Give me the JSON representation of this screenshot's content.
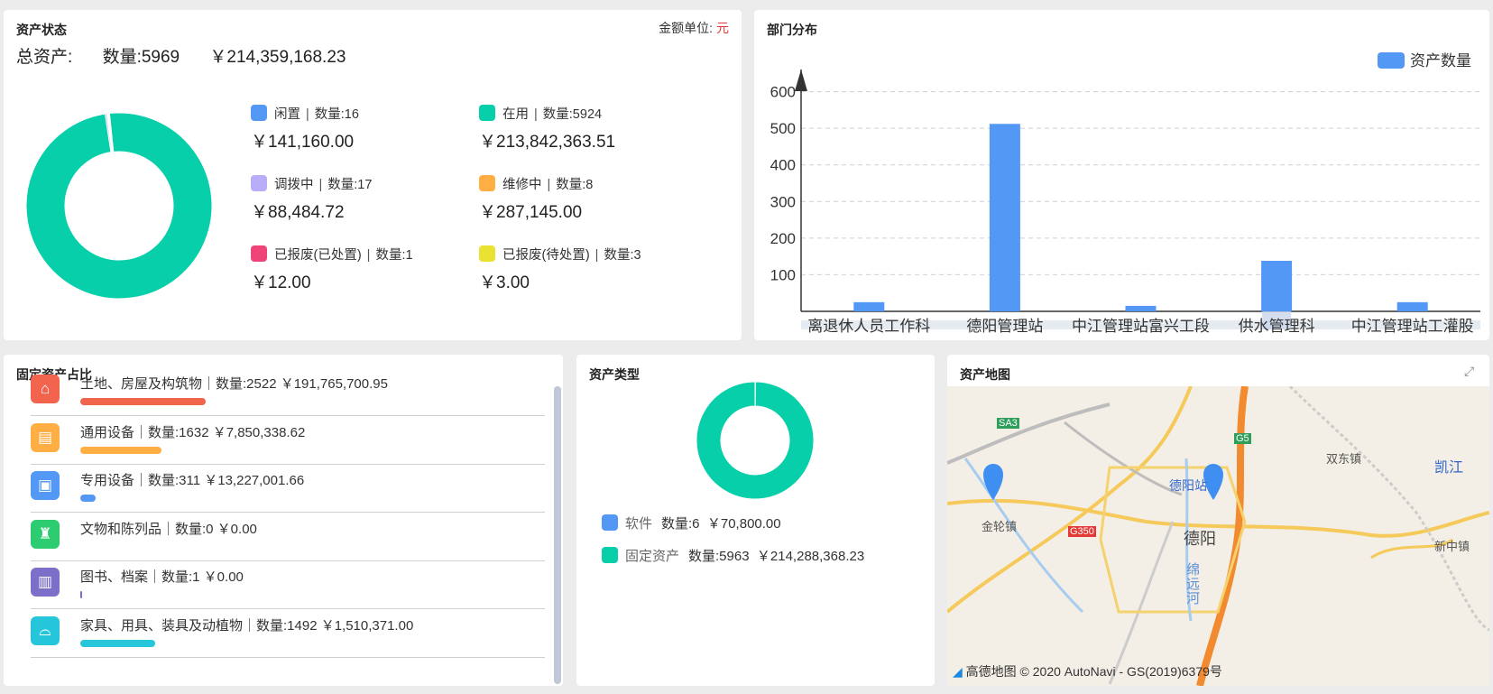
{
  "status_panel": {
    "title": "资产状态",
    "unit_label": "金额单位:",
    "unit_value": "元",
    "total_label": "总资产:",
    "total_count": "数量:5969",
    "total_amount": "￥214,359,168.23",
    "legend": [
      {
        "name": "闲置",
        "count": "数量:16",
        "amount": "￥141,160.00",
        "color": "#5398f5"
      },
      {
        "name": "在用",
        "count": "数量:5924",
        "amount": "￥213,842,363.51",
        "color": "#06cfaa"
      },
      {
        "name": "调拨中",
        "count": "数量:17",
        "amount": "￥88,484.72",
        "color": "#b8aef7"
      },
      {
        "name": "维修中",
        "count": "数量:8",
        "amount": "￥287,145.00",
        "color": "#ffae44"
      },
      {
        "name": "已报废(已处置)",
        "count": "数量:1",
        "amount": "￥12.00",
        "color": "#ef4477"
      },
      {
        "name": "已报废(待处置)",
        "count": "数量:3",
        "amount": "￥3.00",
        "color": "#e9e233"
      }
    ]
  },
  "dept_panel": {
    "title": "部门分布",
    "legend_label": "资产数量",
    "bar_color": "#5398f5"
  },
  "chart_data": [
    {
      "type": "pie",
      "categories": [
        "闲置",
        "在用",
        "调拨中",
        "维修中",
        "已报废(已处置)",
        "已报废(待处置)"
      ],
      "values": [
        16,
        5924,
        17,
        8,
        1,
        3
      ]
    },
    {
      "type": "bar",
      "categories": [
        "离退休人员工作科",
        "德阳管理站",
        "中江管理站富兴工段",
        "供水管理科",
        "中江管理站工灌股"
      ],
      "series": [
        {
          "name": "资产数量",
          "values": [
            25,
            512,
            15,
            138,
            25
          ]
        }
      ],
      "yticks": [
        100,
        200,
        300,
        400,
        500,
        600
      ],
      "ylim": [
        0,
        700
      ],
      "grid": true,
      "legend": "top-right"
    },
    {
      "type": "pie",
      "categories": [
        "软件",
        "固定资产"
      ],
      "values": [
        6,
        5963
      ]
    }
  ],
  "fixed_panel": {
    "title": "固定资产占比",
    "rows": [
      {
        "text": "土地、房屋及构筑物｜数量:2522  ￥191,765,700.95",
        "icon": "house-icon",
        "glyph": "⌂",
        "color": "#f2644e",
        "ratio": 0.4225
      },
      {
        "text": "通用设备｜数量:1632  ￥7,850,338.62",
        "icon": "device-icon",
        "glyph": "▤",
        "color": "#ffae44",
        "ratio": 0.2734
      },
      {
        "text": "专用设备｜数量:311  ￥13,227,001.66",
        "icon": "monitor-icon",
        "glyph": "▣",
        "color": "#5398f5",
        "ratio": 0.0521
      },
      {
        "text": "文物和陈列品｜数量:0  ￥0.00",
        "icon": "relic-icon",
        "glyph": "♜",
        "color": "#2ecc71",
        "ratio": 0
      },
      {
        "text": "图书、档案｜数量:1  ￥0.00",
        "icon": "book-icon",
        "glyph": "▥",
        "color": "#7b6fc9",
        "ratio": 0.0002
      },
      {
        "text": "家具、用具、装具及动植物｜数量:1492  ￥1,510,371.00",
        "icon": "sofa-icon",
        "glyph": "⌓",
        "color": "#26c6da",
        "ratio": 0.25
      }
    ]
  },
  "type_panel": {
    "title": "资产类型",
    "legend": [
      {
        "name": "软件",
        "count": "数量:6",
        "amount": "￥70,800.00",
        "color": "#5398f5"
      },
      {
        "name": "固定资产",
        "count": "数量:5963",
        "amount": "￥214,288,368.23",
        "color": "#06cfaa"
      }
    ]
  },
  "map_panel": {
    "title": "资产地图",
    "credit": "高德地图 © 2020 AutoNavi - GS(2019)6379号",
    "labels": [
      "德阳站",
      "德阳",
      "金轮镇",
      "双东镇",
      "凯江",
      "新中镇",
      "绵远河",
      "G350",
      "SA3",
      "G5"
    ]
  }
}
